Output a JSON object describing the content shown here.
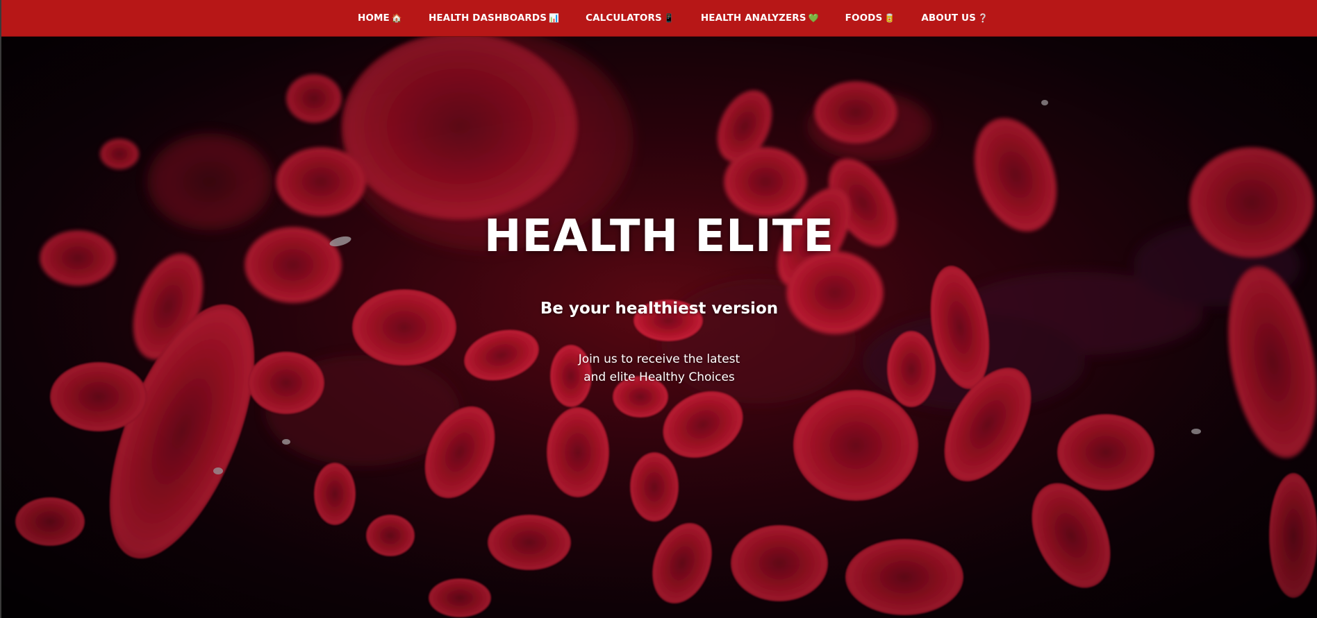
{
  "nav": {
    "items": [
      {
        "label": "HOME",
        "icon": "🏠",
        "icon_name": "house-icon"
      },
      {
        "label": "HEALTH DASHBOARDS",
        "icon": "📊",
        "icon_name": "bar-chart-icon"
      },
      {
        "label": "CALCULATORS",
        "icon": "📱",
        "icon_name": "calculator-icon"
      },
      {
        "label": "HEALTH ANALYZERS",
        "icon": "💚",
        "icon_name": "green-heart-icon"
      },
      {
        "label": "FOODS",
        "icon": "🥫",
        "icon_name": "food-can-icon"
      },
      {
        "label": "ABOUT US",
        "icon": "❔",
        "icon_name": "question-mark-icon"
      }
    ]
  },
  "hero": {
    "title": "HEALTH ELITE",
    "subtitle": "Be your healthiest version",
    "tagline_line1": "Join us to receive the latest",
    "tagline_line2": "and elite Healthy Choices",
    "background_description_icon": "blood-cells-image"
  },
  "colors": {
    "navbar": "#b71717",
    "cell_primary": "#d4142f",
    "cell_dark": "#7a0a1c",
    "text": "#ffffff"
  }
}
